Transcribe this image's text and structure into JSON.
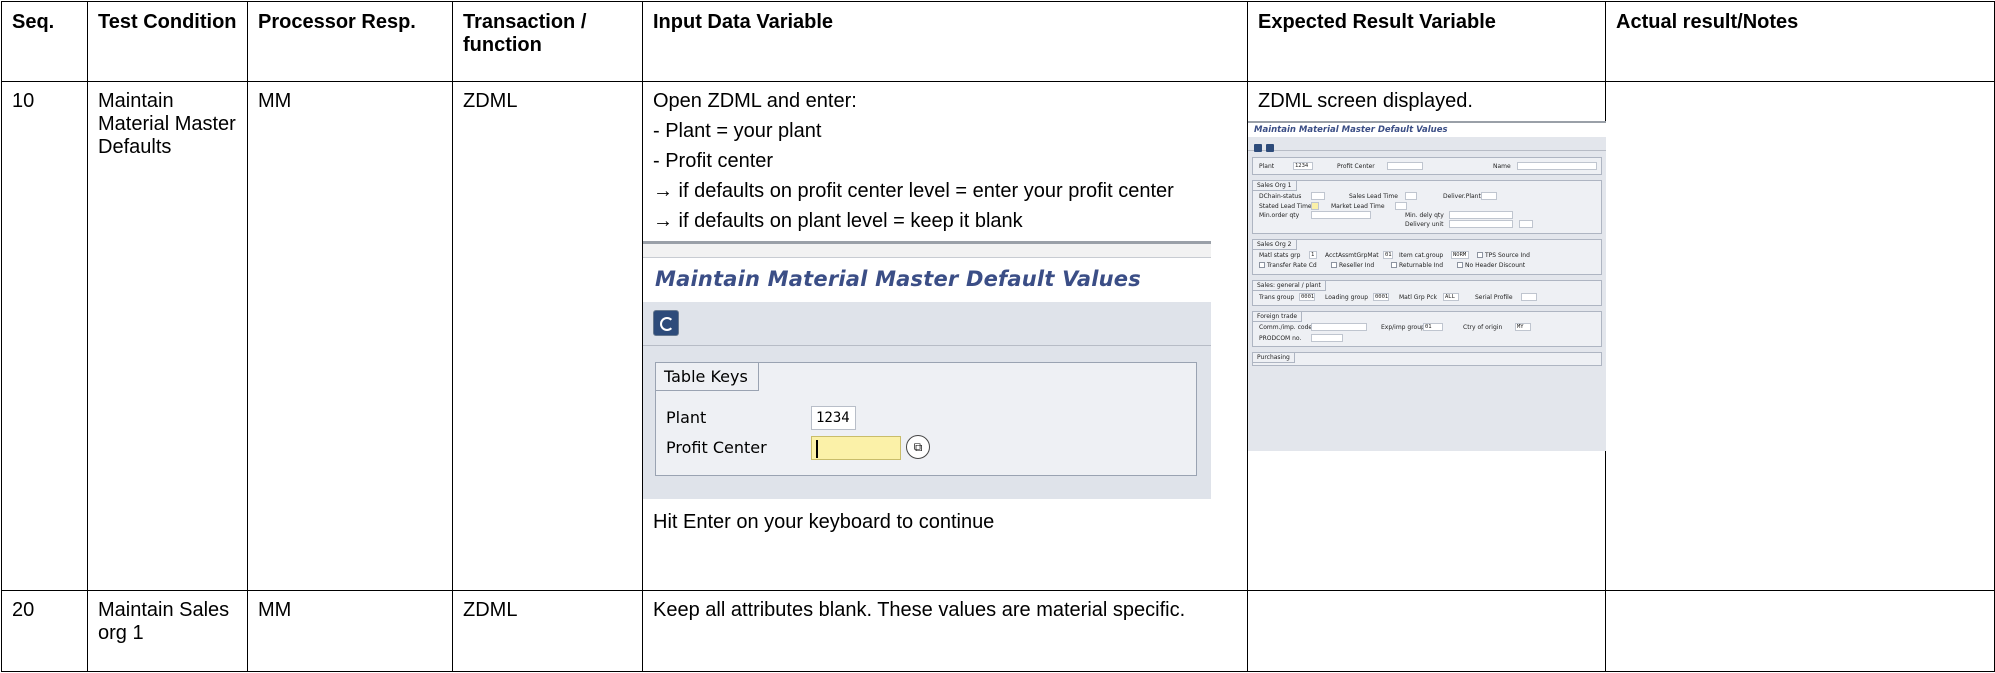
{
  "headers": {
    "seq": "Seq.",
    "condition": "Test Condition",
    "processor": "Processor Resp.",
    "transaction": "Transaction / function",
    "input": "Input Data Variable",
    "expected": "Expected Result Variable",
    "actual": "Actual result/Notes"
  },
  "rows": [
    {
      "seq": "10",
      "condition": "Maintain Material Master Defaults",
      "processor": "MM",
      "transaction": "ZDML",
      "input_lines": [
        "Open ZDML and enter:",
        "- Plant = your plant",
        "- Profit center",
        "→ if defaults on profit center level = enter your profit center",
        "→ if defaults on plant level = keep it blank"
      ],
      "input_after": "Hit Enter on your keyboard to continue",
      "expected": "ZDML screen displayed.",
      "actual": ""
    },
    {
      "seq": "20",
      "condition": "Maintain Sales org 1",
      "processor": "MM",
      "transaction": "ZDML",
      "input": "Keep all attributes blank. These values are material specific.",
      "expected": "",
      "actual": ""
    }
  ],
  "sap_screen": {
    "title": "Maintain Material Master Default Values",
    "group_title": "Table Keys",
    "plant_label": "Plant",
    "plant_value": "1234",
    "profit_center_label": "Profit Center",
    "profit_center_value": "",
    "f4_icon": "f4-help-icon",
    "execute_icon": "execute-icon"
  },
  "thumbnail": {
    "title": "Maintain Material Master Default Values",
    "plant_label": "Plant",
    "plant_value": "1234",
    "profit_center_label": "Profit Center",
    "name_label": "Name",
    "sales_org1": "Sales Org 1",
    "dchain": "DChain-status",
    "sales_lead": "Sales Lead Time",
    "deliver_plant": "Deliver.Plant",
    "stated_lead": "Stated Lead Time",
    "market_lead": "Market Lead Time",
    "min_order": "Min.order qty",
    "min_dely": "Min. dely qty",
    "delivery_unit": "Delivery unit",
    "sales_org2": "Sales Org 2",
    "matl_stats": "Matl stats grp",
    "matl_stats_val": "1",
    "acct_assgmt": "AcctAssmtGrpMat",
    "acct_assgmt_val": "01",
    "item_cat": "Item cat.group",
    "item_cat_val": "NORM",
    "tps_source": "TPS Source Ind",
    "transfer_rate": "Transfer Rate Cd",
    "reseller": "Reseller Ind",
    "returnable": "Returnable Ind",
    "no_header": "No Header Discount",
    "sales_general": "Sales: general / plant",
    "trans_group": "Trans group",
    "trans_group_val": "0001",
    "loading_group": "Loading group",
    "loading_group_val": "0001",
    "matl_grp_pck": "Matl Grp Pck",
    "matl_grp_pck_val": "ALL",
    "serial_profile": "Serial Profile",
    "foreign_trade": "Foreign trade",
    "comm_imp": "Comm./imp. code",
    "exp_imp": "Exp/imp group",
    "exp_imp_val": "01",
    "ctry_origin": "Ctry of origin",
    "ctry_origin_val": "MY",
    "prodcom": "PRODCOM no.",
    "purchasing": "Purchasing"
  }
}
